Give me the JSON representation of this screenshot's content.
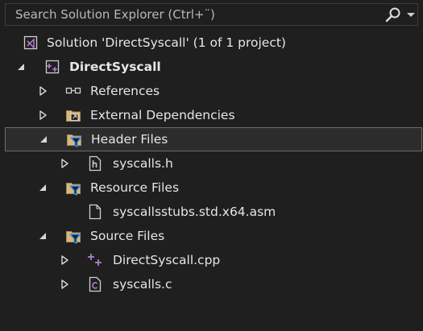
{
  "search": {
    "placeholder": "Search Solution Explorer (Ctrl+¨)"
  },
  "tree": [
    {
      "label": "Solution 'DirectSyscall' (1 of 1 project)",
      "icon": "solution-icon",
      "expander": "none",
      "level": 0,
      "bold": false,
      "selected": false
    },
    {
      "label": "DirectSyscall",
      "icon": "cpp-project-icon",
      "expander": "expanded",
      "level": 1,
      "bold": true,
      "selected": false
    },
    {
      "label": "References",
      "icon": "references-icon",
      "expander": "collapsed",
      "level": 2,
      "bold": false,
      "selected": false
    },
    {
      "label": "External Dependencies",
      "icon": "external-dependencies-icon",
      "expander": "collapsed",
      "level": 2,
      "bold": false,
      "selected": false
    },
    {
      "label": "Header Files",
      "icon": "filter-folder-icon",
      "expander": "expanded",
      "level": 2,
      "bold": false,
      "selected": true
    },
    {
      "label": "syscalls.h",
      "icon": "header-file-icon",
      "expander": "collapsed",
      "level": 3,
      "bold": false,
      "selected": false
    },
    {
      "label": "Resource Files",
      "icon": "filter-folder-icon",
      "expander": "expanded",
      "level": 2,
      "bold": false,
      "selected": false
    },
    {
      "label": "syscallsstubs.std.x64.asm",
      "icon": "file-icon",
      "expander": "none",
      "level": 3,
      "bold": false,
      "selected": false
    },
    {
      "label": "Source Files",
      "icon": "filter-folder-icon",
      "expander": "expanded",
      "level": 2,
      "bold": false,
      "selected": false
    },
    {
      "label": "DirectSyscall.cpp",
      "icon": "cpp-file-icon",
      "expander": "collapsed",
      "level": 3,
      "bold": false,
      "selected": false
    },
    {
      "label": "syscalls.c",
      "icon": "c-file-icon",
      "expander": "collapsed",
      "level": 3,
      "bold": false,
      "selected": false
    }
  ],
  "colors": {
    "background": "#1f1f1f",
    "text": "#e6e6e6",
    "selection_border": "#6c6c6c",
    "folder": "#dcb67a",
    "filter_funnel": "#3794ff",
    "cpp_accent": "#b180d7"
  }
}
